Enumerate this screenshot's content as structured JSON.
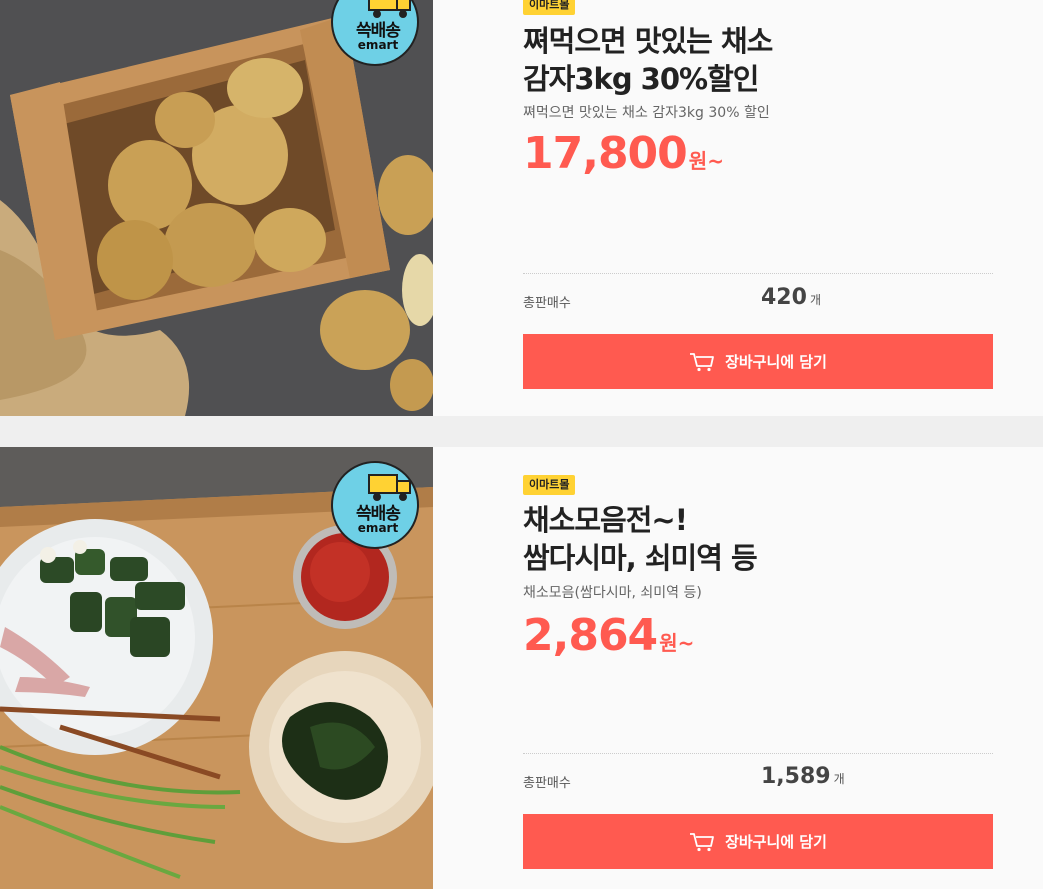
{
  "products": [
    {
      "mall_tag": "이마트몰",
      "title_lines": [
        "쪄먹으면 맛있는 채소",
        "감자3kg 30%할인"
      ],
      "subtitle": "쪄먹으면 맛있는 채소 감자3kg 30% 할인",
      "price": "17,800",
      "price_unit": "원~",
      "sales_label": "총판매수",
      "sales_count": "420",
      "sales_unit": "개",
      "cart_label": "장바구니에 담기",
      "badge_title": "쓱배송",
      "badge_brand": "emart",
      "photo_subject": "potato-box-photo"
    },
    {
      "mall_tag": "이마트몰",
      "title_lines": [
        "채소모음전~!",
        "쌈다시마, 쇠미역 등"
      ],
      "subtitle": "채소모음(쌈다시마, 쇠미역 등)",
      "price": "2,864",
      "price_unit": "원~",
      "sales_label": "총판매수",
      "sales_count": "1,589",
      "sales_unit": "개",
      "cart_label": "장바구니에 담기",
      "badge_title": "쓱배송",
      "badge_brand": "emart",
      "photo_subject": "seaweed-platter-photo"
    }
  ],
  "colors": {
    "accent": "#ff5a50",
    "tag": "#ffd233",
    "badge": "#6ed0e6"
  }
}
